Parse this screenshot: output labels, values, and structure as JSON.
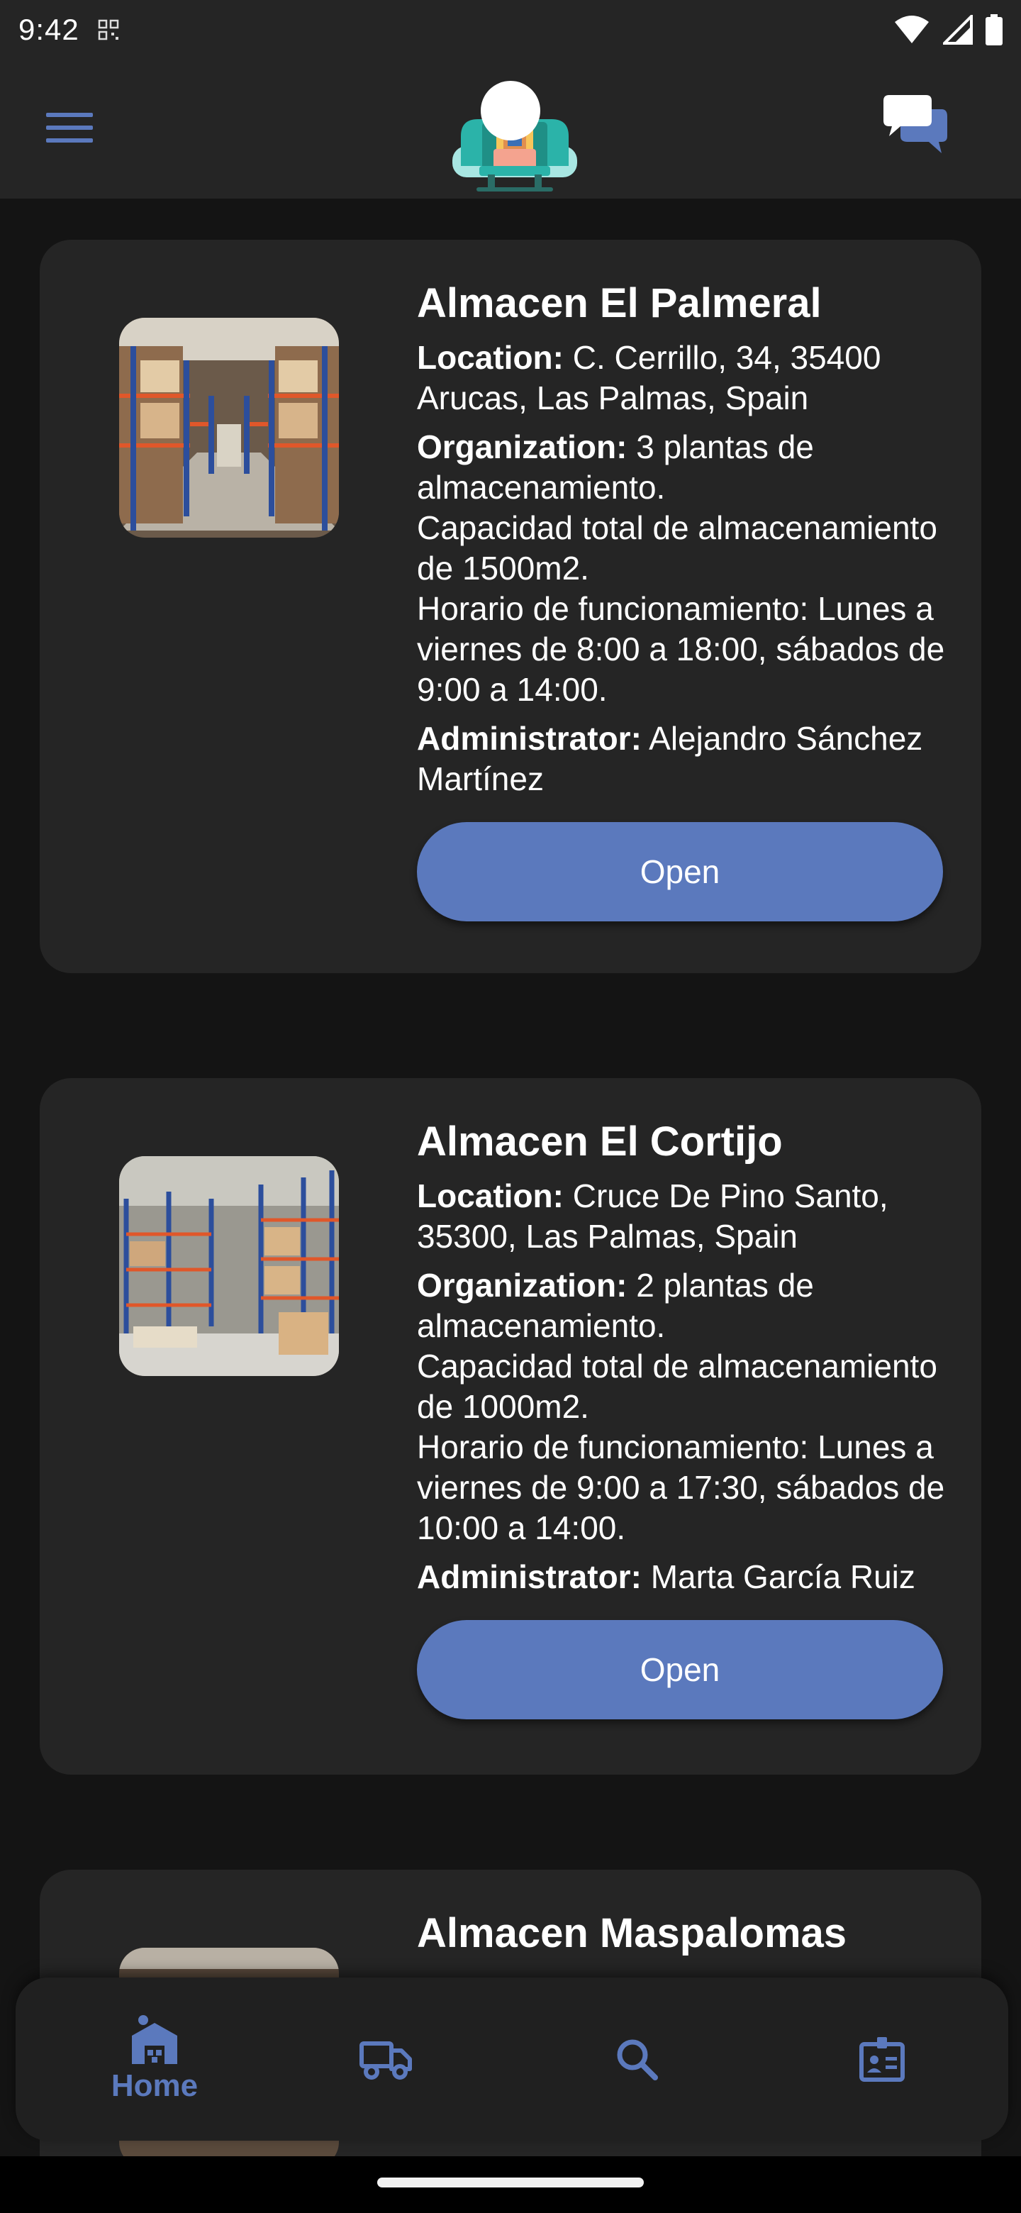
{
  "status_bar": {
    "time": "9:42"
  },
  "colors": {
    "accent": "#5b79bd",
    "card": "#252525",
    "background": "#141414"
  },
  "app_bar": {
    "menu_icon": "hamburger-menu-icon",
    "logo_icon": "warehouse-worker-logo",
    "chat_icon": "chat-bubbles-icon"
  },
  "warehouses": [
    {
      "name": "Almacen El Palmeral",
      "location_label": "Location:",
      "location": "C. Cerrillo, 34, 35400 Arucas, Las Palmas, Spain",
      "organization_label": "Organization:",
      "organization": "3 plantas de almacenamiento.\nCapacidad total de almacenamiento de 1500m2.\nHorario de funcionamiento: Lunes a viernes de 8:00 a 18:00, sábados de 9:00 a 14:00.",
      "administrator_label": "Administrator:",
      "administrator": "Alejandro Sánchez Martínez",
      "open_label": "Open"
    },
    {
      "name": "Almacen El Cortijo",
      "location_label": "Location:",
      "location": "Cruce De Pino Santo, 35300, Las Palmas, Spain",
      "organization_label": "Organization:",
      "organization": "2 plantas de almacenamiento.\nCapacidad total de almacenamiento de 1000m2.\nHorario de funcionamiento: Lunes a viernes de 9:00 a 17:30, sábados de 10:00 a 14:00.",
      "administrator_label": "Administrator:",
      "administrator": "Marta García Ruiz",
      "open_label": "Open"
    },
    {
      "name": "Almacen Maspalomas"
    }
  ],
  "bottom_nav": {
    "items": [
      {
        "label": "Home",
        "icon": "warehouse-icon",
        "active": true
      },
      {
        "label": "",
        "icon": "truck-icon"
      },
      {
        "label": "",
        "icon": "search-icon"
      },
      {
        "label": "",
        "icon": "id-card-icon"
      }
    ]
  }
}
